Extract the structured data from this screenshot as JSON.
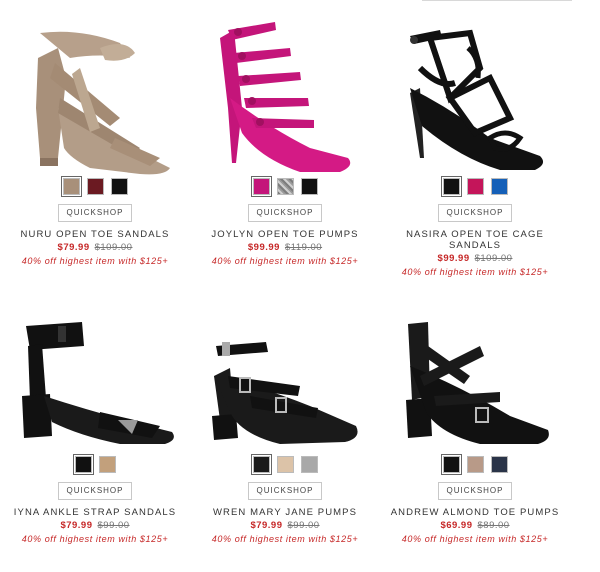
{
  "products": [
    {
      "name": "NURU OPEN TOE SANDALS",
      "sale_price": "$79.99",
      "orig_price": "$109.00",
      "promo": "40% off highest item with $125+",
      "quickshop": "QUICKSHOP",
      "swatches": [
        "#a8907a",
        "#6b1a22",
        "#111111"
      ],
      "image_icon": "lace-up-block-heel-sandal-icon"
    },
    {
      "name": "JOYLYN OPEN TOE PUMPS",
      "sale_price": "$99.99",
      "orig_price": "$119.00",
      "promo": "40% off highest item with $125+",
      "quickshop": "QUICKSHOP",
      "swatches": [
        "#c4157a",
        "snake",
        "#111111"
      ],
      "image_icon": "multi-strap-stiletto-pump-icon"
    },
    {
      "name": "NASIRA OPEN TOE CAGE SANDALS",
      "sale_price": "$99.99",
      "orig_price": "$109.00",
      "promo": "40% off highest item with $125+",
      "quickshop": "QUICKSHOP",
      "swatches": [
        "#111111",
        "#c4155a",
        "#1560b8"
      ],
      "image_icon": "cage-stiletto-sandal-icon"
    },
    {
      "name": "IYNA ANKLE STRAP SANDALS",
      "sale_price": "$79.99",
      "orig_price": "$99.00",
      "promo": "40% off highest item with $125+",
      "quickshop": "QUICKSHOP",
      "swatches": [
        "#111111",
        "#c2a07c"
      ],
      "image_icon": "ankle-strap-block-heel-sandal-icon"
    },
    {
      "name": "WREN MARY JANE PUMPS",
      "sale_price": "$79.99",
      "orig_price": "$99.00",
      "promo": "40% off highest item with $125+",
      "quickshop": "QUICKSHOP",
      "swatches": [
        "#1a1a1a",
        "#dcc3a8",
        "#a8a8a8"
      ],
      "image_icon": "mary-jane-buckle-pump-icon"
    },
    {
      "name": "ANDREW ALMOND TOE PUMPS",
      "sale_price": "$69.99",
      "orig_price": "$89.00",
      "promo": "40% off highest item with $125+",
      "quickshop": "QUICKSHOP",
      "swatches": [
        "#111111",
        "#b89a88",
        "#2a3448"
      ],
      "image_icon": "crisscross-almond-toe-pump-icon"
    }
  ],
  "colors": {
    "sale": "#c62828",
    "promo": "#c62828"
  }
}
